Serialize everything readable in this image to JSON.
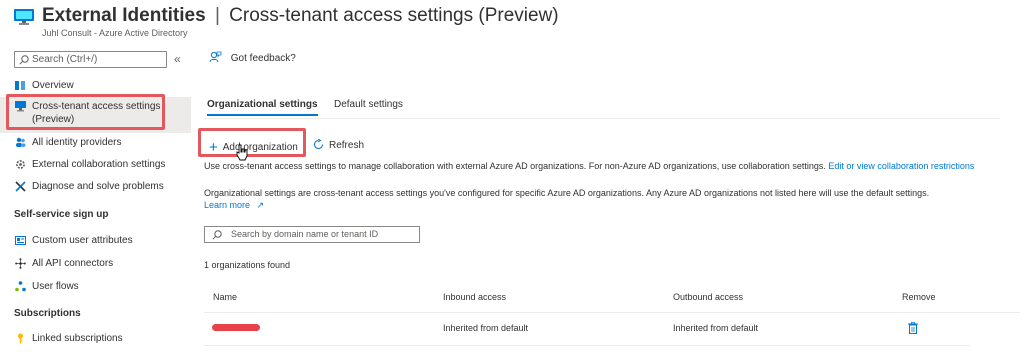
{
  "header": {
    "title_strong": "External Identities",
    "title_sep": "|",
    "title_rest": "Cross-tenant access settings (Preview)",
    "more": "···",
    "subtitle": "Juhl Consult - Azure Active Directory",
    "icon": "azure-ad-icon"
  },
  "sidebar": {
    "search_placeholder": "Search (Ctrl+/)",
    "collapse": "«",
    "items": [
      {
        "label": "Overview",
        "icon": "info-icon"
      },
      {
        "label": "Cross-tenant access settings (Preview)",
        "icon": "monitor-icon",
        "selected": true
      },
      {
        "label": "All identity providers",
        "icon": "users-icon"
      },
      {
        "label": "External collaboration settings",
        "icon": "gear-icon"
      },
      {
        "label": "Diagnose and solve problems",
        "icon": "wrench-icon"
      }
    ],
    "section_self_service": "Self-service sign up",
    "self_service_items": [
      {
        "label": "Custom user attributes",
        "icon": "attributes-icon"
      },
      {
        "label": "All API connectors",
        "icon": "connector-icon"
      },
      {
        "label": "User flows",
        "icon": "flow-icon"
      }
    ],
    "section_subscriptions": "Subscriptions",
    "subscription_items": [
      {
        "label": "Linked subscriptions",
        "icon": "key-icon"
      }
    ]
  },
  "main": {
    "feedback": "Got feedback?",
    "tabs": [
      {
        "label": "Organizational settings",
        "active": true
      },
      {
        "label": "Default settings",
        "active": false
      }
    ],
    "commands": {
      "add": "Add organization",
      "refresh": "Refresh"
    },
    "desc1": "Use cross-tenant access settings to manage collaboration with external Azure AD organizations. For non-Azure AD organizations, use collaboration settings.",
    "desc1_link": "Edit or view collaboration restrictions",
    "desc2": "Organizational settings are cross-tenant access settings you've configured for specific Azure AD organizations. Any Azure AD organizations not listed here will use the default settings.",
    "learn_more": "Learn more",
    "filter_placeholder": "Search by domain name or tenant ID",
    "count": "1 organizations found",
    "table": {
      "headers": [
        "Name",
        "Inbound access",
        "Outbound access",
        "Remove"
      ],
      "rows": [
        {
          "name": "",
          "inbound": "Inherited from default",
          "outbound": "Inherited from default"
        }
      ]
    }
  },
  "colors": {
    "accent": "#0078d4",
    "highlight": "#e2585d",
    "selected_bg": "#edebe9"
  }
}
